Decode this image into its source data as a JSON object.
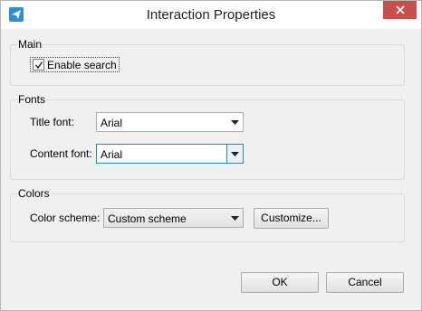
{
  "window": {
    "title": "Interaction Properties"
  },
  "main_group": {
    "label": "Main",
    "enable_search": {
      "label": "Enable search",
      "checked": true
    }
  },
  "fonts_group": {
    "label": "Fonts",
    "title_font": {
      "label": "Title font:",
      "value": "Arial"
    },
    "content_font": {
      "label": "Content font:",
      "value": "Arial"
    }
  },
  "colors_group": {
    "label": "Colors",
    "color_scheme": {
      "label": "Color scheme:",
      "value": "Custom scheme"
    },
    "customize_label": "Customize..."
  },
  "buttons": {
    "ok": "OK",
    "cancel": "Cancel"
  },
  "icons": {
    "app": "paper-plane-icon",
    "close": "close-icon",
    "dropdown": "chevron-down-icon",
    "check": "check-icon"
  },
  "colors": {
    "close_button": "#c7504b",
    "focus_border": "#3c7fb1",
    "app_icon": "#2f8fd6"
  }
}
